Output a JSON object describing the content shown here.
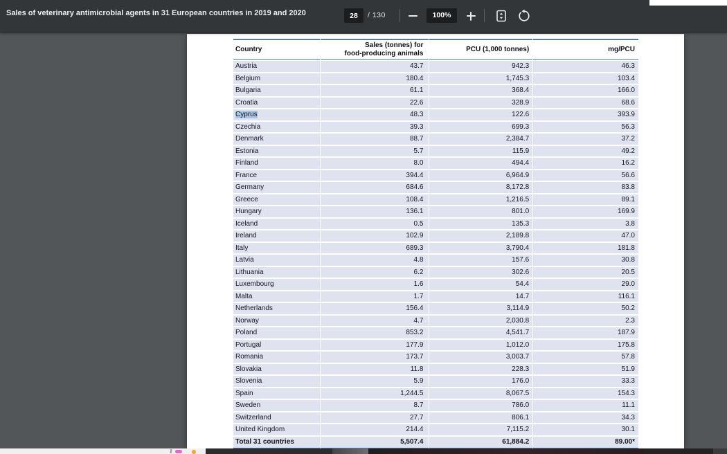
{
  "toolbar": {
    "title": "Sales of veterinary antimicrobial agents in 31 European countries in 2019 and 2020",
    "page_current": "28",
    "page_total_label": "/ 130",
    "zoom_level": "100%",
    "icons": {
      "zoom_out": "minus-icon",
      "zoom_in": "plus-icon",
      "fit": "fit-to-page-icon",
      "rotate": "rotate-counterclockwise-icon"
    }
  },
  "colors": {
    "toolbar_bg": "#323639",
    "viewer_bg": "#525659",
    "table_accent_blue": "#4a7eba",
    "row_band": "#dfe2ef",
    "text_selection": "#a9c7e4"
  },
  "table": {
    "headers": {
      "country": "Country",
      "sales_line1": "Sales (tonnes) for",
      "sales_line2": "food-producing animals",
      "pcu": "PCU (1,000 tonnes)",
      "mg_pcu": "mg/PCU"
    },
    "rows": [
      {
        "country": "Austria",
        "sales": "43.7",
        "pcu": "942.3",
        "mg_pcu": "46.3",
        "highlighted": false
      },
      {
        "country": "Belgium",
        "sales": "180.4",
        "pcu": "1,745.3",
        "mg_pcu": "103.4",
        "highlighted": false
      },
      {
        "country": "Bulgaria",
        "sales": "61.1",
        "pcu": "368.4",
        "mg_pcu": "166.0",
        "highlighted": false
      },
      {
        "country": "Croatia",
        "sales": "22.6",
        "pcu": "328.9",
        "mg_pcu": "68.6",
        "highlighted": false
      },
      {
        "country": "Cyprus",
        "sales": "48.3",
        "pcu": "122.6",
        "mg_pcu": "393.9",
        "highlighted": true
      },
      {
        "country": "Czechia",
        "sales": "39.3",
        "pcu": "699.3",
        "mg_pcu": "56.3",
        "highlighted": false
      },
      {
        "country": "Denmark",
        "sales": "88.7",
        "pcu": "2,384.7",
        "mg_pcu": "37.2",
        "highlighted": false
      },
      {
        "country": "Estonia",
        "sales": "5.7",
        "pcu": "115.9",
        "mg_pcu": "49.2",
        "highlighted": false
      },
      {
        "country": "Finland",
        "sales": "8.0",
        "pcu": "494.4",
        "mg_pcu": "16.2",
        "highlighted": false
      },
      {
        "country": "France",
        "sales": "394.4",
        "pcu": "6,964.9",
        "mg_pcu": "56.6",
        "highlighted": false
      },
      {
        "country": "Germany",
        "sales": "684.6",
        "pcu": "8,172.8",
        "mg_pcu": "83.8",
        "highlighted": false
      },
      {
        "country": "Greece",
        "sales": "108.4",
        "pcu": "1,216.5",
        "mg_pcu": "89.1",
        "highlighted": false
      },
      {
        "country": "Hungary",
        "sales": "136.1",
        "pcu": "801.0",
        "mg_pcu": "169.9",
        "highlighted": false
      },
      {
        "country": "Iceland",
        "sales": "0.5",
        "pcu": "135.3",
        "mg_pcu": "3.8",
        "highlighted": false
      },
      {
        "country": "Ireland",
        "sales": "102.9",
        "pcu": "2,189.8",
        "mg_pcu": "47.0",
        "highlighted": false
      },
      {
        "country": "Italy",
        "sales": "689.3",
        "pcu": "3,790.4",
        "mg_pcu": "181.8",
        "highlighted": false
      },
      {
        "country": "Latvia",
        "sales": "4.8",
        "pcu": "157.6",
        "mg_pcu": "30.8",
        "highlighted": false
      },
      {
        "country": "Lithuania",
        "sales": "6.2",
        "pcu": "302.6",
        "mg_pcu": "20.5",
        "highlighted": false
      },
      {
        "country": "Luxembourg",
        "sales": "1.6",
        "pcu": "54.4",
        "mg_pcu": "29.0",
        "highlighted": false
      },
      {
        "country": "Malta",
        "sales": "1.7",
        "pcu": "14.7",
        "mg_pcu": "116.1",
        "highlighted": false
      },
      {
        "country": "Netherlands",
        "sales": "156.4",
        "pcu": "3,114.9",
        "mg_pcu": "50.2",
        "highlighted": false
      },
      {
        "country": "Norway",
        "sales": "4.7",
        "pcu": "2,030.8",
        "mg_pcu": "2.3",
        "highlighted": false
      },
      {
        "country": "Poland",
        "sales": "853.2",
        "pcu": "4,541.7",
        "mg_pcu": "187.9",
        "highlighted": false
      },
      {
        "country": "Portugal",
        "sales": "177.9",
        "pcu": "1,012.0",
        "mg_pcu": "175.8",
        "highlighted": false
      },
      {
        "country": "Romania",
        "sales": "173.7",
        "pcu": "3,003.7",
        "mg_pcu": "57.8",
        "highlighted": false
      },
      {
        "country": "Slovakia",
        "sales": "11.8",
        "pcu": "228.3",
        "mg_pcu": "51.9",
        "highlighted": false
      },
      {
        "country": "Slovenia",
        "sales": "5.9",
        "pcu": "176.0",
        "mg_pcu": "33.3",
        "highlighted": false
      },
      {
        "country": "Spain",
        "sales": "1,244.5",
        "pcu": "8,067.5",
        "mg_pcu": "154.3",
        "highlighted": false
      },
      {
        "country": "Sweden",
        "sales": "8.7",
        "pcu": "786.0",
        "mg_pcu": "11.1",
        "highlighted": false
      },
      {
        "country": "Switzerland",
        "sales": "27.7",
        "pcu": "806.1",
        "mg_pcu": "34.3",
        "highlighted": false
      },
      {
        "country": "United Kingdom",
        "sales": "214.4",
        "pcu": "7,115.2",
        "mg_pcu": "30.1",
        "highlighted": false
      }
    ],
    "total": {
      "country": "Total 31 countries",
      "sales": "5,507.4",
      "pcu": "61,884.2",
      "mg_pcu": "89.00*"
    }
  }
}
